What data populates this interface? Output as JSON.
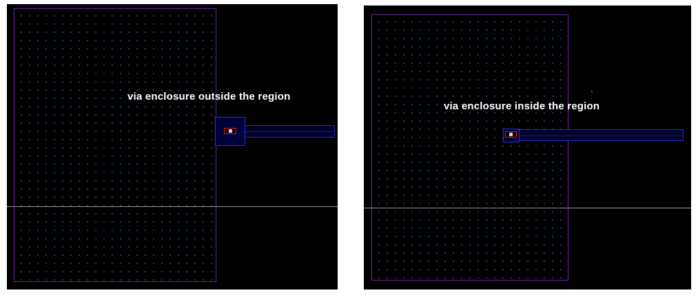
{
  "panels": [
    {
      "id": "outside",
      "caption": "via enclosure outside the region"
    },
    {
      "id": "inside",
      "caption": "via enclosure inside the region"
    }
  ],
  "colors": {
    "canvas": "#000000",
    "region_border": "#6a2a9a",
    "grid_dot": "#1d3f7a",
    "metal_outline": "#1e2ec8",
    "via_cut_outline": "#e02020",
    "via_core": "#c8d8ff",
    "guide_line": "#9a9a9a"
  }
}
